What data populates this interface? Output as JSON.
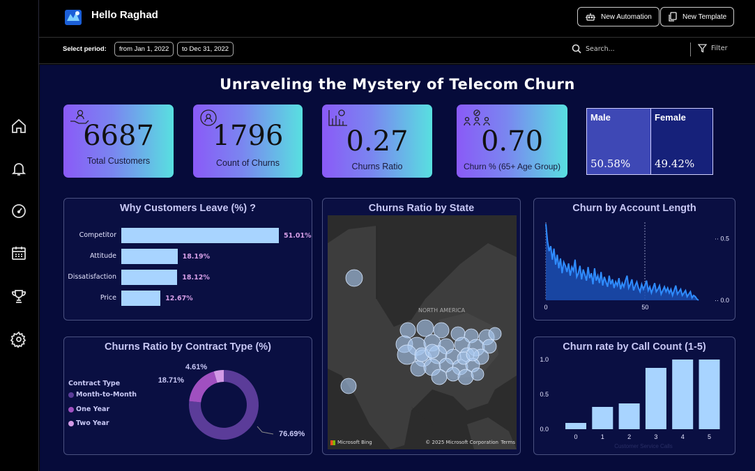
{
  "header": {
    "greeting": "Hello Raghad",
    "new_automation": "New Automation",
    "new_template": "New Template"
  },
  "period": {
    "label": "Select period:",
    "from": "from Jan 1, 2022",
    "to": "to Dec 31, 2022",
    "search_placeholder": "Search...",
    "filter_label": "Filter"
  },
  "sidebar": {
    "icons": [
      "home-icon",
      "bell-icon",
      "gauge-icon",
      "calendar-icon",
      "trophy-icon",
      "gear-icon"
    ]
  },
  "dashboard": {
    "title": "Unraveling the Mystery of Telecom Churn"
  },
  "kpis": [
    {
      "value": "6687",
      "label": "Total Customers",
      "icon": "customers-icon"
    },
    {
      "value": "1796",
      "label": "Count of Churns",
      "icon": "churn-count-icon"
    },
    {
      "value": "0.27",
      "label": "Churns Ratio",
      "icon": "ratio-chart-icon"
    },
    {
      "value": "0.70",
      "label": "Churn % (65+ Age Group)",
      "icon": "age-group-icon"
    }
  ],
  "gender": {
    "male_label": "Male",
    "male_value": "50.58%",
    "female_label": "Female",
    "female_value": "49.42%",
    "male_color": "#3e48b5",
    "female_color": "#16217a"
  },
  "colors": {
    "bar": "#a8d4ff",
    "line": "#2f8cff",
    "area": "#1b4fb3",
    "donut_month": "#5b3c99",
    "donut_one": "#a050c0",
    "donut_two": "#d39ae6",
    "bubble": "#a8c8f0"
  },
  "chart_data": [
    {
      "id": "why_leave",
      "type": "bar",
      "orientation": "horizontal",
      "title": "Why Customers Leave (%) ?",
      "categories": [
        "Competitor",
        "Attitude",
        "Dissatisfaction",
        "Price"
      ],
      "values": [
        51.01,
        18.19,
        18.12,
        12.67
      ],
      "labels": [
        "51.01%",
        "18.19%",
        "18.12%",
        "12.67%"
      ]
    },
    {
      "id": "contract",
      "type": "pie",
      "subtype": "donut",
      "title": "Churns Ratio by Contract Type (%)",
      "legend_title": "Contract Type",
      "categories": [
        "Month-to-Month",
        "One Year",
        "Two Year"
      ],
      "values": [
        76.69,
        18.71,
        4.61
      ],
      "labels": [
        "76.69%",
        "18.71%",
        "4.61%"
      ]
    },
    {
      "id": "state_map",
      "type": "scatter",
      "subtype": "bubble-map",
      "title": "Churns Ratio by State",
      "region_label": "NORTH AMERICA",
      "credit_left": "Microsoft Bing",
      "credit_right": "© 2025 Microsoft Corporation",
      "terms": "Terms"
    },
    {
      "id": "account_length",
      "type": "area",
      "title": "Churn by Account Length",
      "xlim": [
        0,
        100
      ],
      "ylim": [
        0,
        0.6
      ],
      "x_ticks": [
        "0",
        "50"
      ],
      "y_ticks": [
        "0.0",
        "0.5"
      ],
      "y": [
        0.62,
        0.48,
        0.4,
        0.44,
        0.33,
        0.42,
        0.29,
        0.37,
        0.26,
        0.34,
        0.22,
        0.31,
        0.28,
        0.23,
        0.3,
        0.2,
        0.27,
        0.24,
        0.33,
        0.19,
        0.22,
        0.28,
        0.17,
        0.25,
        0.21,
        0.16,
        0.27,
        0.18,
        0.22,
        0.13,
        0.26,
        0.16,
        0.2,
        0.14,
        0.23,
        0.12,
        0.19,
        0.15,
        0.11,
        0.2,
        0.13,
        0.17,
        0.1,
        0.15,
        0.12,
        0.18,
        0.09,
        0.14,
        0.11,
        0.16,
        0.2,
        0.1,
        0.13,
        0.17,
        0.08,
        0.12,
        0.15,
        0.1,
        0.07,
        0.13,
        0.09,
        0.12,
        0.16,
        0.08,
        0.11,
        0.06,
        0.1,
        0.14,
        0.07,
        0.09,
        0.12,
        0.05,
        0.08,
        0.11,
        0.07,
        0.1,
        0.06,
        0.09,
        0.04,
        0.08,
        0.12,
        0.05,
        0.07,
        0.09,
        0.04,
        0.06,
        0.08,
        0.03,
        0.05,
        0.07,
        0.02,
        0.04,
        0.03,
        0.01,
        0.0
      ]
    },
    {
      "id": "call_count",
      "type": "bar",
      "title": "Churn rate by Call Count (1-5)",
      "categories": [
        "0",
        "1",
        "2",
        "3",
        "4",
        "5"
      ],
      "values": [
        0.09,
        0.32,
        0.37,
        0.88,
        1.0,
        1.0
      ],
      "ylim": [
        0,
        1.0
      ],
      "y_ticks": [
        "0.0",
        "0.5",
        "1.0"
      ],
      "xlabel": "Customer Service Calls"
    }
  ]
}
